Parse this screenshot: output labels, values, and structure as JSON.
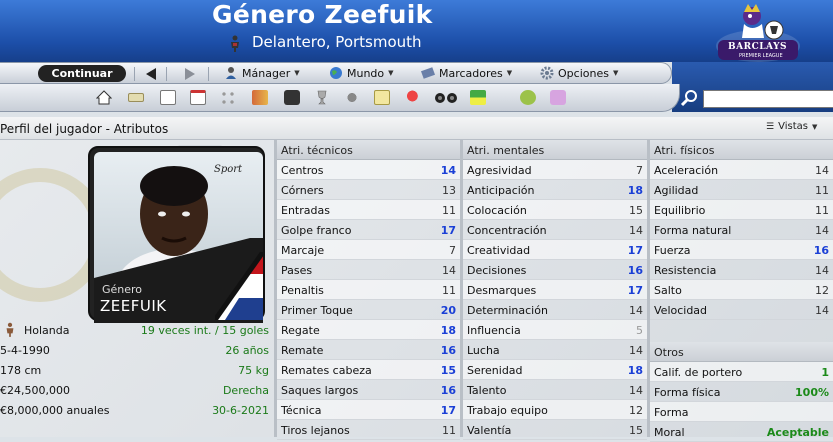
{
  "header": {
    "player_name": "Género Zeefuik",
    "subtitle": "Delantero, Portsmouth",
    "league_logo_text": "BARCLAYS",
    "league_logo_sub": "PREMIER LEAGUE"
  },
  "toolbar": {
    "continue_label": "Continuar",
    "manager_label": "Mánager",
    "world_label": "Mundo",
    "bookmarks_label": "Marcadores",
    "options_label": "Opciones"
  },
  "panel": {
    "title": "Perfil del jugador - Atributos",
    "views_label": "Vistas"
  },
  "player": {
    "first_name": "Género",
    "last_name": "ZEEFUIK",
    "nationality": "Holanda",
    "caps": "19 veces int. / 15 goles",
    "birth_date": "5-4-1990",
    "age": "26 años",
    "height": "178 cm",
    "weight": "75 kg",
    "value": "€24,500,000",
    "foot": "Derecha",
    "wage": "€8,000,000 anuales",
    "contract_end": "30-6-2021"
  },
  "technical": {
    "header": "Atri. técnicos",
    "rows": [
      {
        "name": "Centros",
        "value": "14",
        "style": "blue"
      },
      {
        "name": "Córners",
        "value": "13",
        "style": "dark"
      },
      {
        "name": "Entradas",
        "value": "11",
        "style": "dark"
      },
      {
        "name": "Golpe franco",
        "value": "17",
        "style": "blue"
      },
      {
        "name": "Marcaje",
        "value": "7",
        "style": "dark"
      },
      {
        "name": "Pases",
        "value": "14",
        "style": "dark"
      },
      {
        "name": "Penaltis",
        "value": "11",
        "style": "dark"
      },
      {
        "name": "Primer Toque",
        "value": "20",
        "style": "blue"
      },
      {
        "name": "Regate",
        "value": "18",
        "style": "blue"
      },
      {
        "name": "Remate",
        "value": "16",
        "style": "blue"
      },
      {
        "name": "Remates cabeza",
        "value": "15",
        "style": "blue"
      },
      {
        "name": "Saques largos",
        "value": "16",
        "style": "blue"
      },
      {
        "name": "Técnica",
        "value": "17",
        "style": "blue"
      },
      {
        "name": "Tiros lejanos",
        "value": "11",
        "style": "dark"
      }
    ]
  },
  "mental": {
    "header": "Atri. mentales",
    "rows": [
      {
        "name": "Agresividad",
        "value": "7",
        "style": "dark"
      },
      {
        "name": "Anticipación",
        "value": "18",
        "style": "blue"
      },
      {
        "name": "Colocación",
        "value": "15",
        "style": "dark"
      },
      {
        "name": "Concentración",
        "value": "14",
        "style": "dark"
      },
      {
        "name": "Creatividad",
        "value": "17",
        "style": "blue"
      },
      {
        "name": "Decisiones",
        "value": "16",
        "style": "blue"
      },
      {
        "name": "Desmarques",
        "value": "17",
        "style": "blue"
      },
      {
        "name": "Determinación",
        "value": "14",
        "style": "dark"
      },
      {
        "name": "Influencia",
        "value": "5",
        "style": "gray"
      },
      {
        "name": "Lucha",
        "value": "14",
        "style": "dark"
      },
      {
        "name": "Serenidad",
        "value": "18",
        "style": "blue"
      },
      {
        "name": "Talento",
        "value": "14",
        "style": "dark"
      },
      {
        "name": "Trabajo equipo",
        "value": "12",
        "style": "dark"
      },
      {
        "name": "Valentía",
        "value": "15",
        "style": "dark"
      }
    ]
  },
  "physical": {
    "header": "Atri. físicos",
    "rows": [
      {
        "name": "Aceleración",
        "value": "14",
        "style": "dark"
      },
      {
        "name": "Agilidad",
        "value": "11",
        "style": "dark"
      },
      {
        "name": "Equilibrio",
        "value": "11",
        "style": "dark"
      },
      {
        "name": "Forma natural",
        "value": "14",
        "style": "dark"
      },
      {
        "name": "Fuerza",
        "value": "16",
        "style": "blue"
      },
      {
        "name": "Resistencia",
        "value": "14",
        "style": "dark"
      },
      {
        "name": "Salto",
        "value": "12",
        "style": "dark"
      },
      {
        "name": "Velocidad",
        "value": "14",
        "style": "dark"
      }
    ]
  },
  "other": {
    "header": "Otros",
    "rows": [
      {
        "name": "Calif. de portero",
        "value": "1",
        "style": "green"
      },
      {
        "name": "Forma física",
        "value": "100%",
        "style": "green"
      },
      {
        "name": "Forma",
        "value": "",
        "style": "green"
      },
      {
        "name": "Moral",
        "value": "Aceptable",
        "style": "green"
      }
    ]
  },
  "colors": {
    "header_blue": "#1c4ea8",
    "value_blue": "#1a3fd6",
    "value_green": "#1b8a19"
  }
}
